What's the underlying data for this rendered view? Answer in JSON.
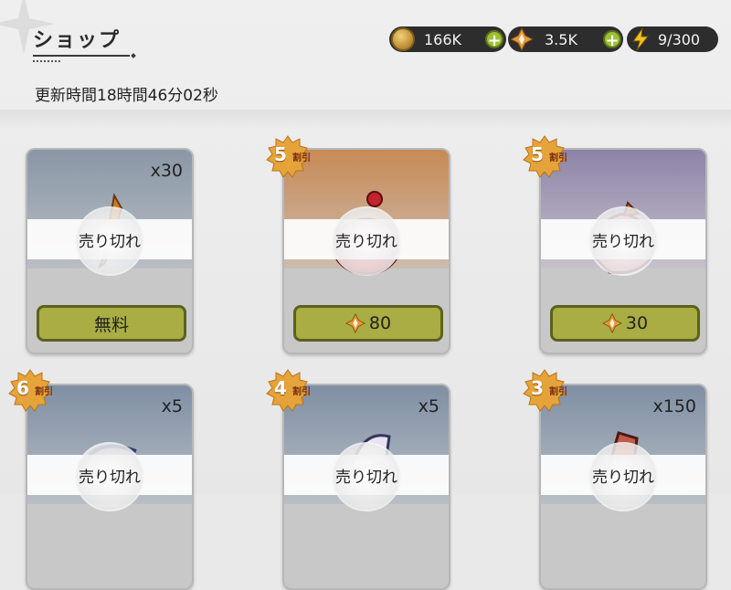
{
  "header": {
    "title": "ショップ",
    "refresh_text": "更新時間18時間46分02秒"
  },
  "resources": [
    {
      "icon": "coin-icon",
      "value": "166K"
    },
    {
      "icon": "gem-icon",
      "value": "3.5K"
    },
    {
      "icon": "energy-icon",
      "value": "9/300"
    }
  ],
  "cards": [
    {
      "qty": "x30",
      "status": "売り切れ",
      "price": "無料",
      "price_icon": "",
      "discount": "",
      "discount_label": "",
      "bg_top": "#8a97a6"
    },
    {
      "qty": "",
      "status": "売り切れ",
      "price": "80",
      "price_icon": "gem-icon",
      "discount": "5",
      "discount_label": "割引",
      "bg_top": "#c88a55"
    },
    {
      "qty": "",
      "status": "売り切れ",
      "price": "30",
      "price_icon": "gem-icon",
      "discount": "5",
      "discount_label": "割引",
      "bg_top": "#8d83a8"
    },
    {
      "qty": "x5",
      "status": "売り切れ",
      "price": "",
      "price_icon": "",
      "discount": "6",
      "discount_label": "割引",
      "bg_top": "#7f8fa4"
    },
    {
      "qty": "x5",
      "status": "売り切れ",
      "price": "",
      "price_icon": "",
      "discount": "4",
      "discount_label": "割引",
      "bg_top": "#7f8fa4"
    },
    {
      "qty": "x150",
      "status": "売り切れ",
      "price": "",
      "price_icon": "",
      "discount": "3",
      "discount_label": "割引",
      "bg_top": "#7f8fa4"
    }
  ],
  "colors": {
    "price_button": "#a9ad43",
    "resource_bar": "#2d2d2d",
    "plus_button": "#9dbf35"
  }
}
